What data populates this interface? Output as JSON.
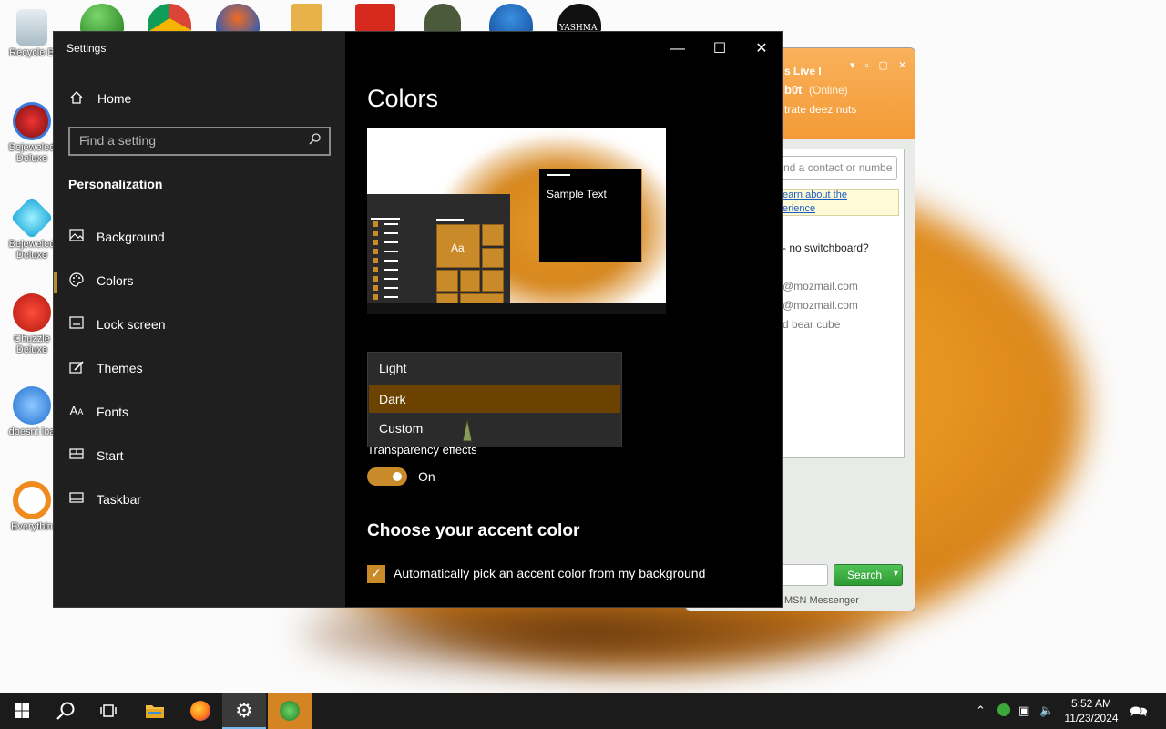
{
  "desktop": {
    "icons": [
      {
        "label": "Recycle B",
        "icon": "recycle-bin-icon"
      },
      {
        "label": "Bejeweled",
        "label2": "Deluxe",
        "icon": "bejeweled-icon"
      },
      {
        "label": "Bejeweled",
        "label2": "Deluxe",
        "icon": "bejeweled-gem-icon"
      },
      {
        "label": "Chuzzle",
        "label2": "Deluxe",
        "icon": "chuzzle-icon"
      },
      {
        "label": "doesnt loa",
        "icon": "thunderbird-icon"
      },
      {
        "label": "Everythin",
        "icon": "everything-search-icon"
      }
    ],
    "top_icon_label": "YASHMA"
  },
  "msn": {
    "title": "s Live I",
    "user": "b0t",
    "status": "(Online)",
    "personal": "trate deez nuts",
    "find_placeholder": "nd a contact or numbe",
    "learn1": "earn about the",
    "learn2": "erience",
    "line1": "- no switchboard?",
    "line2": "@mozmail.com",
    "line3": "@mozmail.com",
    "line4": "d bear cube",
    "search_label": "Search",
    "footer": "MSN Messenger"
  },
  "settings": {
    "window_title": "Settings",
    "home_label": "Home",
    "search_placeholder": "Find a setting",
    "section": "Personalization",
    "nav": [
      {
        "label": "Background",
        "icon": "image-icon"
      },
      {
        "label": "Colors",
        "icon": "palette-icon"
      },
      {
        "label": "Lock screen",
        "icon": "lock-screen-icon"
      },
      {
        "label": "Themes",
        "icon": "brush-icon"
      },
      {
        "label": "Fonts",
        "icon": "fonts-icon"
      },
      {
        "label": "Start",
        "icon": "start-icon"
      },
      {
        "label": "Taskbar",
        "icon": "taskbar-icon"
      }
    ],
    "page_title": "Colors",
    "preview_text": "Sample Text",
    "preview_aa": "Aa",
    "mode_options": [
      "Light",
      "Dark",
      "Custom"
    ],
    "mode_selected": "Dark",
    "transparency_label": "Transparency effects",
    "transparency_state": "On",
    "accent_title": "Choose your accent color",
    "auto_accent_label": "Automatically pick an accent color from my background",
    "accent_color": "#c98a2a"
  },
  "taskbar": {
    "time": "5:52 AM",
    "date": "11/23/2024",
    "apps": [
      "start-icon",
      "search-icon",
      "task-view-icon",
      "file-explorer-icon",
      "firefox-icon",
      "settings-icon",
      "msn-icon"
    ]
  }
}
